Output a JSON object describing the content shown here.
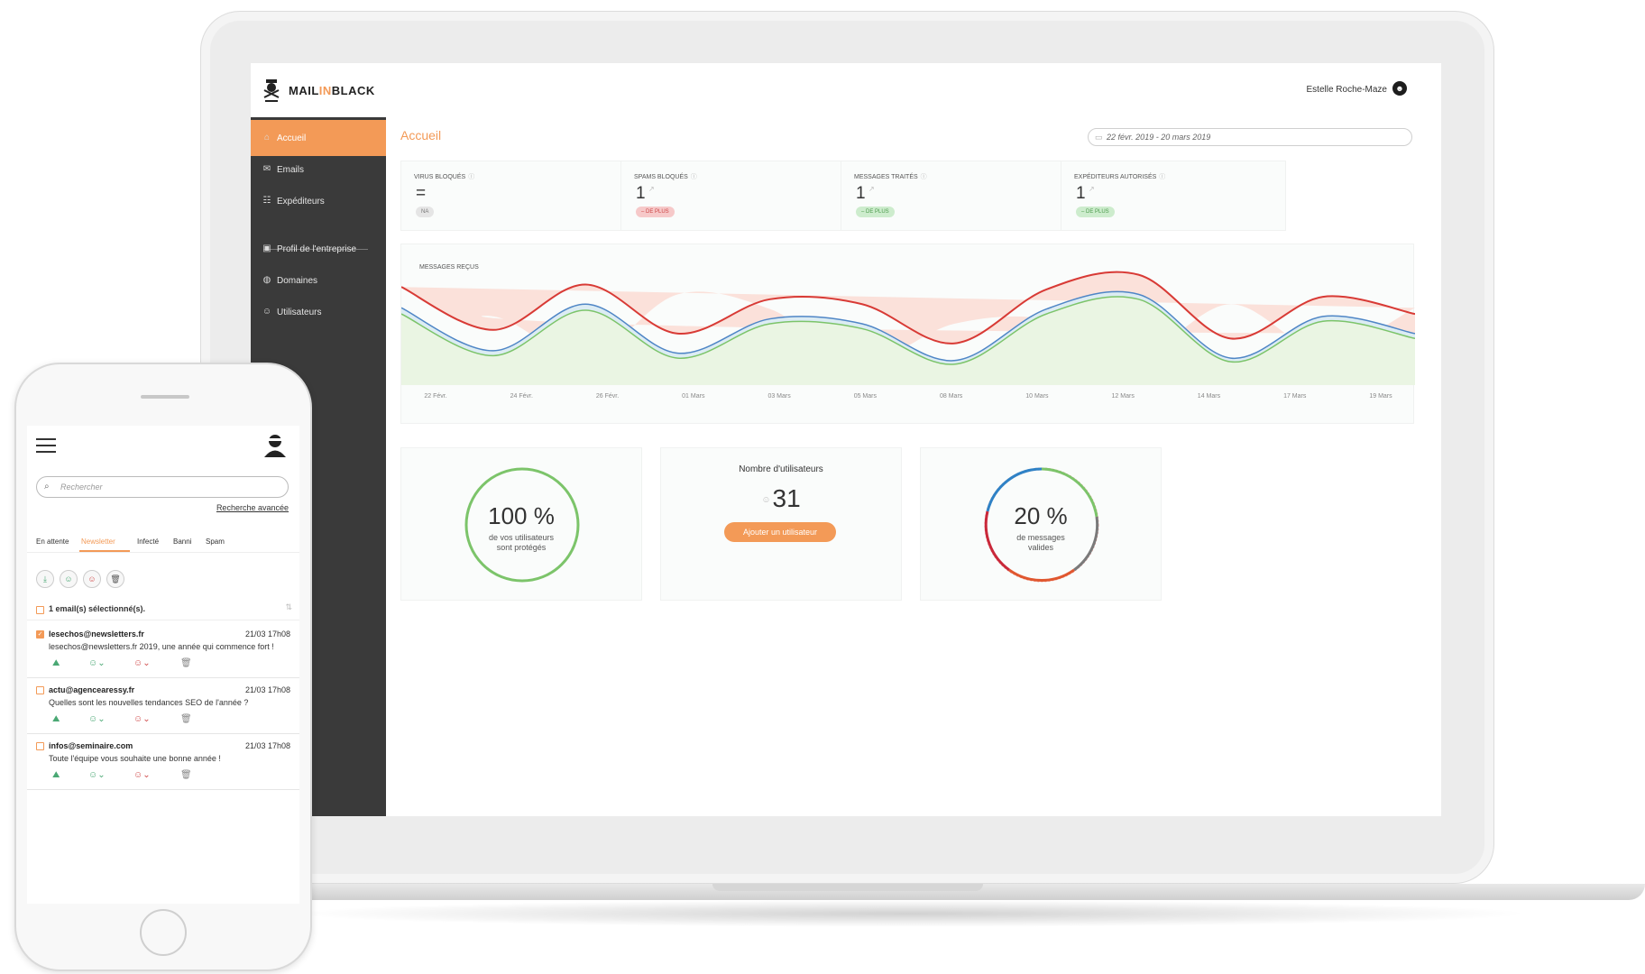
{
  "laptop": {
    "brand": {
      "prefix": "MAIL",
      "accent": "IN",
      "suffix": "BLACK"
    },
    "user_name": "Estelle Roche-Maze",
    "page_title": "Accueil",
    "date_range": "22 févr. 2019 - 20 mars 2019",
    "sidebar": {
      "items": [
        {
          "label": "Accueil",
          "icon": "home-icon",
          "active": true
        },
        {
          "label": "Emails",
          "icon": "envelope-icon"
        },
        {
          "label": "Expéditeurs",
          "icon": "group-icon"
        },
        {
          "label": "Profil de l'entreprise",
          "icon": "profile-card-icon"
        },
        {
          "label": "Domaines",
          "icon": "globe-icon"
        },
        {
          "label": "Utilisateurs",
          "icon": "user-icon"
        }
      ]
    },
    "stats": [
      {
        "label": "Virus bloqués",
        "value": "=",
        "badge": "NA",
        "badge_style": "gray"
      },
      {
        "label": "Spams bloqués",
        "value": "1",
        "badge": "– DE PLUS",
        "badge_style": "red"
      },
      {
        "label": "Messages traités",
        "value": "1",
        "badge": "– DE PLUS",
        "badge_style": "green"
      },
      {
        "label": "Expéditeurs autorisés",
        "value": "1",
        "badge": "– DE PLUS",
        "badge_style": "green"
      }
    ],
    "chart_title": "Messages reçus",
    "protected": {
      "value": "100 %",
      "caption_1": "de vos utilisateurs",
      "caption_2": "sont protégés"
    },
    "users": {
      "title": "Nombre d'utilisateurs",
      "count": "31",
      "button": "Ajouter un utilisateur"
    },
    "valid": {
      "value": "20 %",
      "caption_1": "de messages",
      "caption_2": "valides"
    },
    "colors": {
      "accent": "#f39a57",
      "sidebar": "#3a3a3a",
      "red": "#d83a35",
      "blue": "#4f86c6",
      "green": "#7cc46a"
    }
  },
  "chart_data": {
    "type": "area",
    "title": "Messages reçus",
    "x": [
      "22 Févr.",
      "24 Févr.",
      "26 Févr.",
      "01 Mars",
      "03 Mars",
      "05 Mars",
      "08 Mars",
      "10 Mars",
      "12 Mars",
      "14 Mars",
      "17 Mars",
      "19 Mars"
    ],
    "tick_labels": [
      "22 Févr.",
      "24 Févr.",
      "26 Févr.",
      "01 Mars",
      "03 Mars",
      "05 Mars",
      "08 Mars",
      "10 Mars",
      "12 Mars",
      "14 Mars",
      "17 Mars",
      "19 Mars"
    ],
    "series": [
      {
        "color": "#d83a35",
        "values": [
          0.8,
          0.45,
          0.82,
          0.42,
          0.7,
          0.66,
          0.34,
          0.78,
          0.9,
          0.38,
          0.72,
          0.58
        ]
      },
      {
        "color": "#4f86c6",
        "values": [
          0.63,
          0.28,
          0.66,
          0.26,
          0.54,
          0.5,
          0.2,
          0.62,
          0.74,
          0.22,
          0.56,
          0.42
        ]
      },
      {
        "color": "#7cc46a",
        "values": [
          0.58,
          0.24,
          0.61,
          0.22,
          0.5,
          0.46,
          0.17,
          0.58,
          0.7,
          0.19,
          0.52,
          0.38
        ]
      }
    ],
    "grid": false,
    "legend": "none"
  },
  "phone": {
    "search_placeholder": "Rechercher",
    "advanced_search": "Recherche avancée",
    "tabs": [
      "En attente",
      "Newsletter",
      "Infecté",
      "Banni",
      "Spam"
    ],
    "active_tab": "Newsletter",
    "selected_text": "1 email(s) sélectionné(s).",
    "emails": [
      {
        "from": "lesechos@newsletters.fr",
        "time": "21/03 17h08",
        "subject": "lesechos@newsletters.fr 2019, une année qui commence fort !",
        "checked": true
      },
      {
        "from": "actu@agencearessy.fr",
        "time": "21/03 17h08",
        "subject": "Quelles sont les nouvelles tendances SEO de l'année ?",
        "checked": false
      },
      {
        "from": "infos@seminaire.com",
        "time": "21/03 17h08",
        "subject": "Toute l'équipe vous souhaite une bonne année !",
        "checked": false
      }
    ]
  }
}
